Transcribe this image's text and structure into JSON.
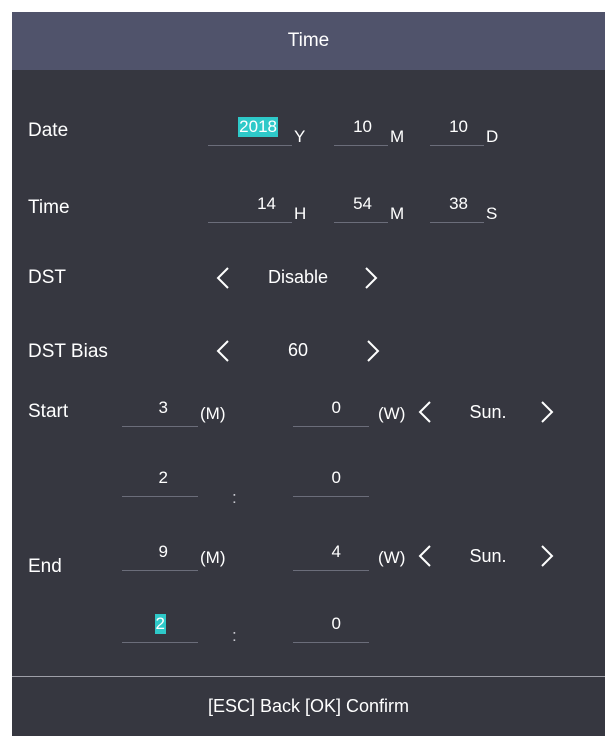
{
  "header": {
    "title": "Time"
  },
  "date": {
    "label": "Date",
    "year": {
      "value": "2018",
      "unit": "Y"
    },
    "month": {
      "value": "10",
      "unit": "M"
    },
    "day": {
      "value": "10",
      "unit": "D"
    }
  },
  "time": {
    "label": "Time",
    "hour": {
      "value": "14",
      "unit": "H"
    },
    "minute": {
      "value": "54",
      "unit": "M"
    },
    "second": {
      "value": "38",
      "unit": "S"
    }
  },
  "dst": {
    "label": "DST",
    "value": "Disable"
  },
  "dst_bias": {
    "label": "DST Bias",
    "value": "60"
  },
  "start": {
    "label": "Start",
    "month": {
      "value": "3",
      "unit": "(M)"
    },
    "week": {
      "value": "0",
      "unit": "(W)"
    },
    "weekday": "Sun.",
    "hour": "2",
    "minute": "0",
    "separator": ":"
  },
  "end": {
    "label": "End",
    "month": {
      "value": "9",
      "unit": "(M)"
    },
    "week": {
      "value": "4",
      "unit": "(W)"
    },
    "weekday": "Sun.",
    "hour": "2",
    "minute": "0",
    "separator": ":"
  },
  "footer": {
    "hint": "[ESC] Back [OK] Confirm"
  },
  "colors": {
    "background": "#363740",
    "header": "#50536b",
    "highlight": "#2ec9c9"
  }
}
